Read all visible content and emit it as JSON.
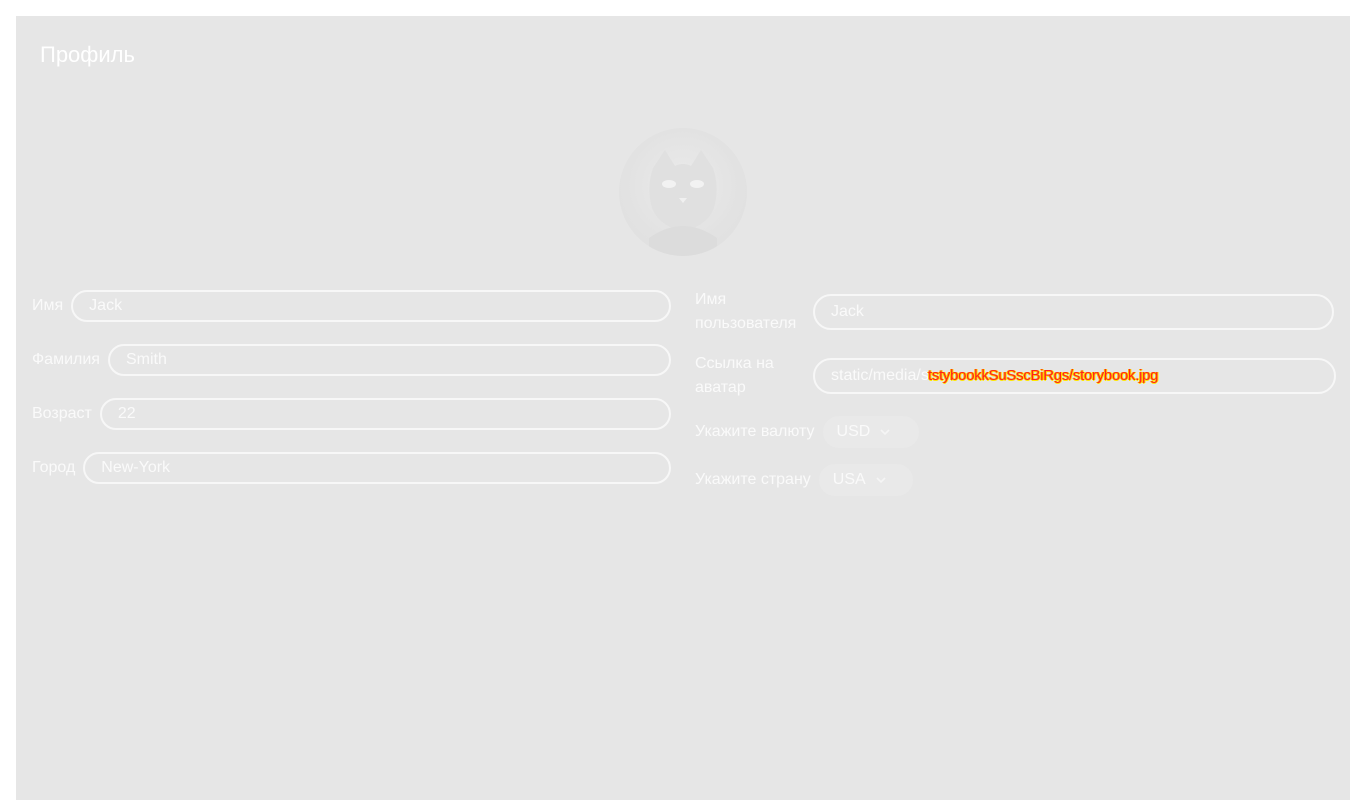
{
  "page": {
    "title": "Профиль"
  },
  "avatar": {
    "icon": "cat-avatar-icon"
  },
  "left_fields": [
    {
      "label": "Имя",
      "value": "Jack"
    },
    {
      "label": "Фамилия",
      "value": "Smith"
    },
    {
      "label": "Возраст",
      "value": "22"
    },
    {
      "label": "Город",
      "value": "New-York"
    }
  ],
  "right_fields": {
    "username": {
      "label": "Имя пользователя",
      "value": "Jack"
    },
    "avatar_link": {
      "label": "Ссылка на аватар",
      "value": "static/media/s",
      "overlay": "tstybookkSuSscBiRgs/storybook.jpg"
    },
    "currency": {
      "label": "Укажите валюту",
      "value": "USD"
    },
    "country": {
      "label": "Укажите страну",
      "value": "USA"
    }
  },
  "colors": {
    "background": "#e6e6e6",
    "text": "#fafafa",
    "border": "#f7f7f7",
    "overlay_red": "#ff1f1f",
    "overlay_yellow": "#ffe500"
  }
}
